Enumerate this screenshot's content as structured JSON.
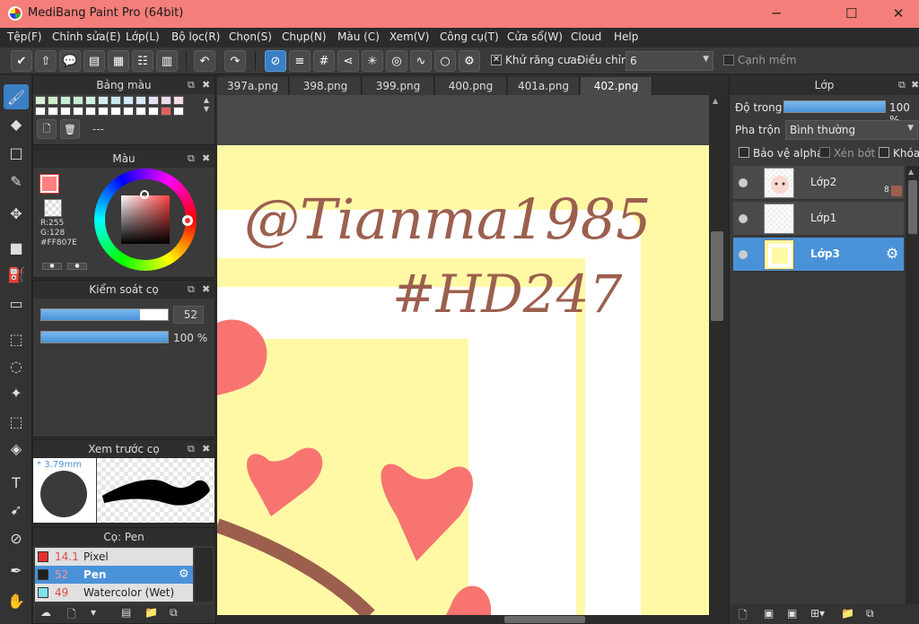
{
  "window": {
    "title": "MediBang Paint Pro (64bit)",
    "minimize": "─",
    "maximize": "☐",
    "close": "✕"
  },
  "menu": [
    "Tệp(F)",
    "Chỉnh sửa(E)",
    "Lớp(L)",
    "Bộ lọc(R)",
    "Chọn(S)",
    "Chụp(N)",
    "Màu (C)",
    "Xem(V)",
    "Công cụ(T)",
    "Cửa sổ(W)",
    "Cloud",
    "Help"
  ],
  "toolbar": {
    "antialias_label": "Khử răng cưa",
    "antialias_checked": "✕",
    "adjust_label": "Điều chỉnh",
    "adjust_value": "6",
    "soft_edge_label": "Cạnh mềm"
  },
  "palette": {
    "title": "Bảng màu",
    "set_name": "---"
  },
  "color": {
    "title": "Màu",
    "r": "R:255",
    "g": "G:128",
    "hex": "#FF807E",
    "primary": "#ff807e"
  },
  "brush_control": {
    "title": "Kiểm soát cọ",
    "size": "52",
    "size_fraction": 0.78,
    "opacity": "100 %",
    "opacity_fraction": 1.0
  },
  "brush_preview": {
    "title": "Xem trước cọ",
    "size_label": "3.79mm"
  },
  "brush_list": {
    "title": "Cọ: Pen",
    "items": [
      {
        "size": "14.1",
        "name": "Pixel",
        "color": "#e03030"
      },
      {
        "size": "52",
        "name": "Pen",
        "color": "#202020"
      },
      {
        "size": "49",
        "name": "Watercolor (Wet)",
        "color": "#80e0f0"
      }
    ]
  },
  "tabs": [
    "397a.png",
    "398.png",
    "399.png",
    "400.png",
    "401a.png",
    "402.png"
  ],
  "canvas": {
    "watermark_line1": "@Tianma1985",
    "watermark_line2": "#HD247",
    "bg": "#fff9a6",
    "heart_color": "#f87470",
    "ink_color": "#9c5f4e"
  },
  "layers": {
    "title": "Lớp",
    "opacity_label": "Độ trong",
    "opacity_value": "100 %",
    "blend_label": "Pha trộn",
    "blend_value": "Bình thường",
    "protect_alpha": "Bảo vệ alpha",
    "clipping": "Xén bớt",
    "lock": "Khóa",
    "items": [
      {
        "name": "Lớp2",
        "badge": "8"
      },
      {
        "name": "Lớp1"
      },
      {
        "name": "Lớp3"
      }
    ]
  }
}
